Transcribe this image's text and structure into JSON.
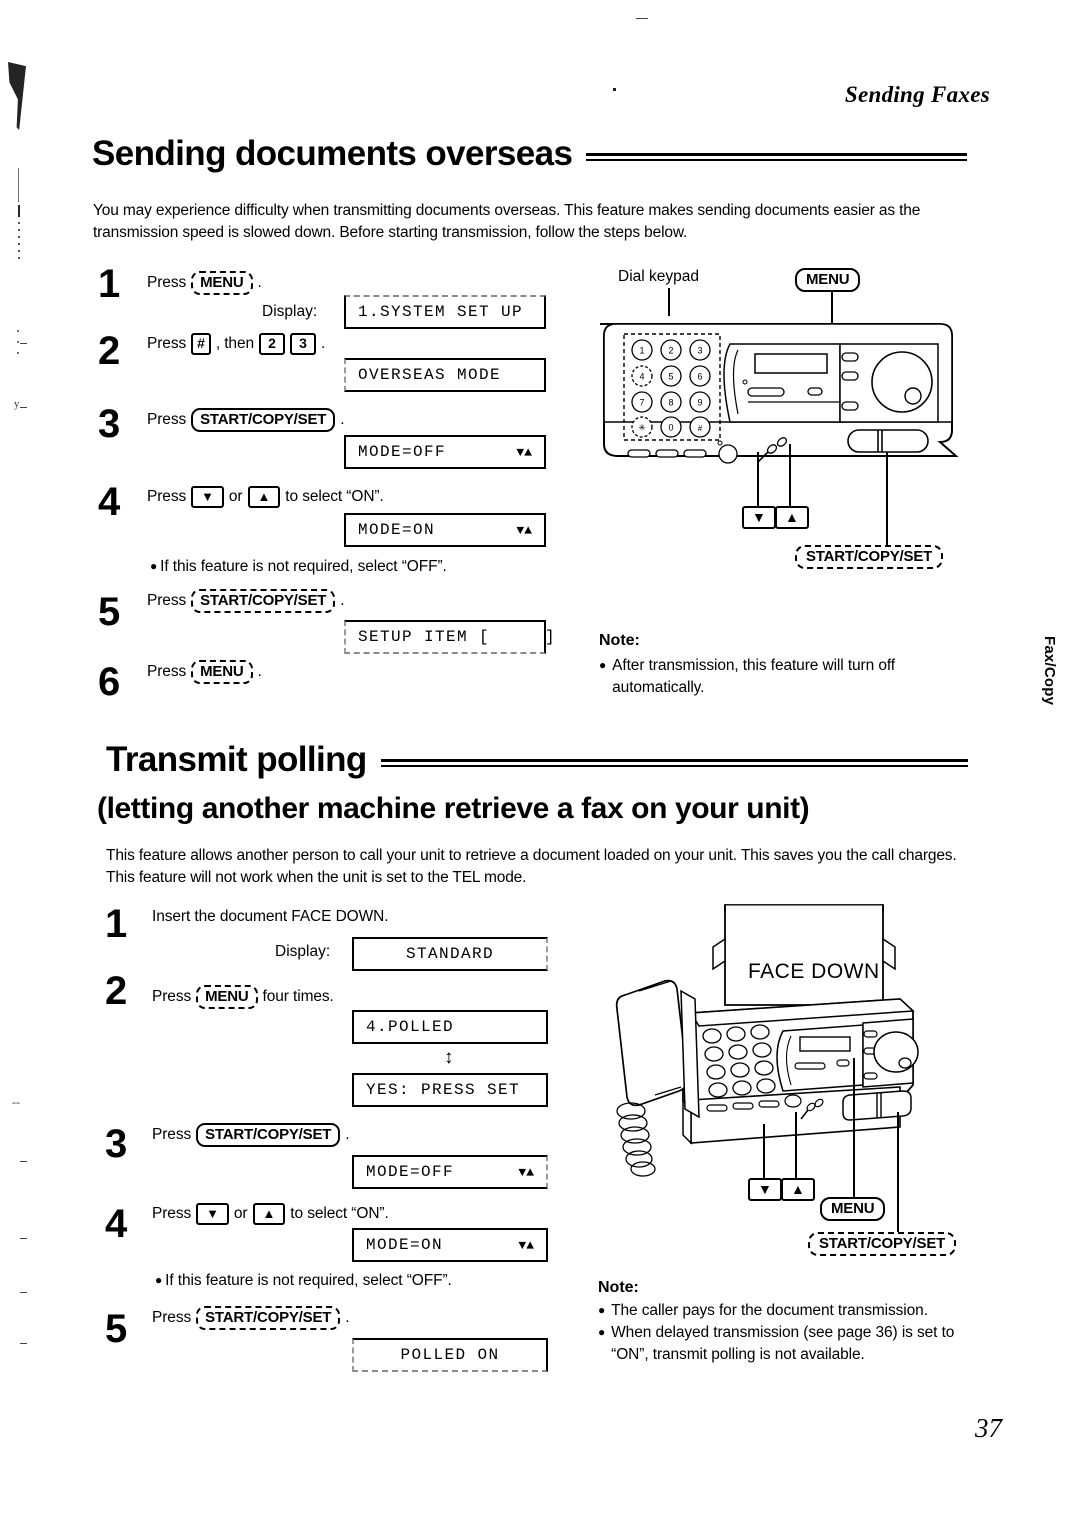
{
  "running_head": "Sending Faxes",
  "page_number": "37",
  "side_tab": "Fax/Copy",
  "sections": [
    {
      "id": "overseas",
      "heading": "Sending documents overseas",
      "intro": "You may experience difficulty when transmitting documents overseas. This feature makes sending documents easier as the transmission speed is slowed down. Before starting transmission, follow the steps below.",
      "steps": [
        {
          "num": "1",
          "text_before": "Press",
          "key": "MENU",
          "text_after": ".",
          "display_label": "Display:",
          "lcd": "1.SYSTEM SET UP"
        },
        {
          "num": "2",
          "text_before": "Press",
          "key": "#",
          "text_mid": ", then",
          "key2": "2",
          "key3": "3",
          "text_after": ".",
          "lcd": "OVERSEAS MODE"
        },
        {
          "num": "3",
          "text_before": "Press",
          "key": "START/COPY/SET",
          "text_after": ".",
          "lcd": "MODE=OFF",
          "lcd_arrows": "▼▲"
        },
        {
          "num": "4",
          "text_before": "Press",
          "key": "▼",
          "text_mid": "or",
          "key2": "▲",
          "text_after": "to select “ON”.",
          "lcd": "MODE=ON",
          "lcd_arrows": "▼▲",
          "bullet": "If this feature is not required, select “OFF”."
        },
        {
          "num": "5",
          "text_before": "Press",
          "key": "START/COPY/SET",
          "text_after": ".",
          "lcd": "SETUP ITEM [     ]"
        },
        {
          "num": "6",
          "text_before": "Press",
          "key": "MENU",
          "text_after": "."
        }
      ],
      "figure": {
        "caption_dial": "Dial keypad",
        "label_menu": "MENU",
        "label_start": "START/COPY/SET",
        "keypad": [
          "1",
          "2",
          "3",
          "4",
          "5",
          "6",
          "7",
          "8",
          "9",
          "✳",
          "0",
          "#"
        ],
        "arrow_down": "▼",
        "arrow_up": "▲"
      },
      "note": {
        "title": "Note:",
        "items": [
          "After transmission, this feature will turn off automatically."
        ]
      }
    },
    {
      "id": "polling",
      "heading": "Transmit polling",
      "subheading": "(letting another machine retrieve a fax on your unit)",
      "intro": "This feature allows another person to call your unit to retrieve a document loaded on your unit. This saves you the call charges. This feature will not work when the unit is set to the TEL mode.",
      "steps": [
        {
          "num": "1",
          "text_plain": "Insert the document FACE DOWN.",
          "display_label": "Display:",
          "lcd": "STANDARD"
        },
        {
          "num": "2",
          "text_before": "Press",
          "key": "MENU",
          "text_after": "four times.",
          "lcd": "4.POLLED",
          "lcd_updown": "↕",
          "lcd2": "YES: PRESS SET"
        },
        {
          "num": "3",
          "text_before": "Press",
          "key": "START/COPY/SET",
          "text_after": ".",
          "lcd": "MODE=OFF",
          "lcd_arrows": "▼▲"
        },
        {
          "num": "4",
          "text_before": "Press",
          "key": "▼",
          "text_mid": "or",
          "key2": "▲",
          "text_after": "to select “ON”.",
          "lcd": "MODE=ON",
          "lcd_arrows": "▼▲",
          "bullet": "If this feature is not required, select “OFF”."
        },
        {
          "num": "5",
          "text_before": "Press",
          "key": "START/COPY/SET",
          "text_after": ".",
          "lcd": "POLLED ON"
        }
      ],
      "figure": {
        "paper_label": "FACE DOWN",
        "label_menu": "MENU",
        "label_start": "START/COPY/SET",
        "arrow_down": "▼",
        "arrow_up": "▲"
      },
      "note": {
        "title": "Note:",
        "items": [
          "The caller pays for the document transmission.",
          "When delayed transmission (see page 36) is set to “ON”, transmit polling is not available."
        ]
      }
    }
  ]
}
